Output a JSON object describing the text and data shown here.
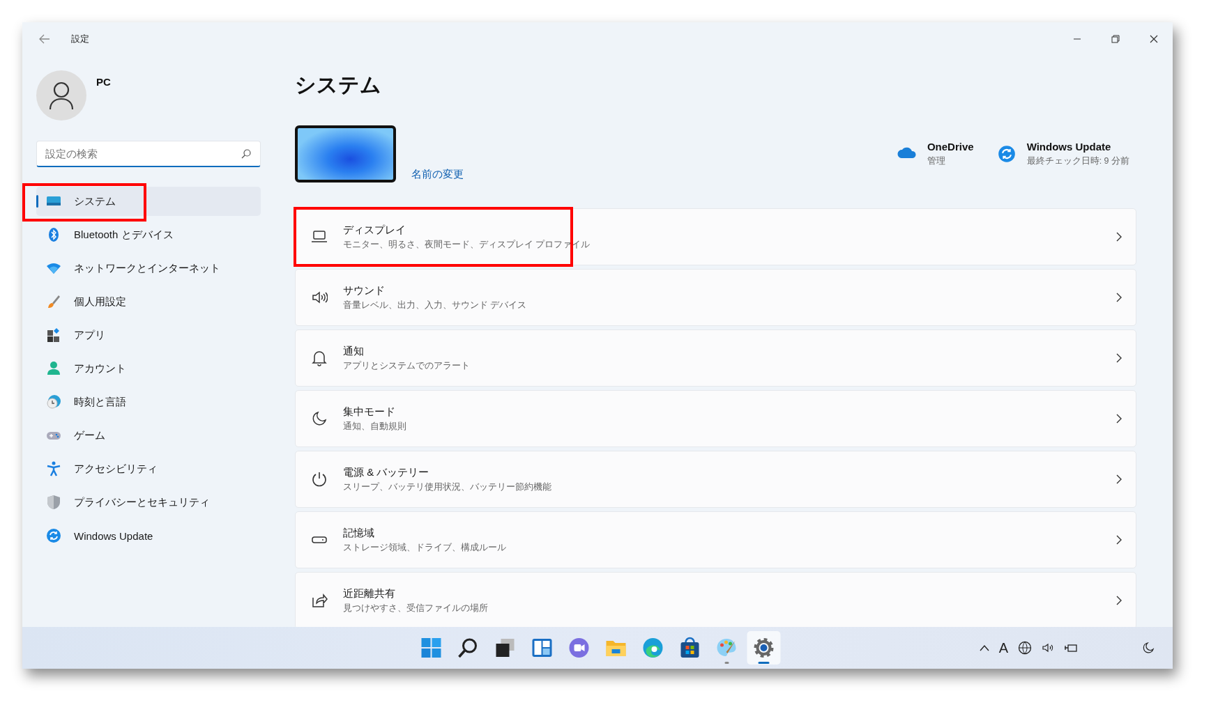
{
  "window": {
    "title": "設定"
  },
  "user": {
    "name": "PC"
  },
  "search": {
    "placeholder": "設定の検索"
  },
  "nav": [
    {
      "label": "システム",
      "selected": true,
      "highlighted": true
    },
    {
      "label": "Bluetooth とデバイス",
      "selected": false,
      "highlighted": false
    },
    {
      "label": "ネットワークとインターネット",
      "selected": false,
      "highlighted": false
    },
    {
      "label": "個人用設定",
      "selected": false,
      "highlighted": false
    },
    {
      "label": "アプリ",
      "selected": false,
      "highlighted": false
    },
    {
      "label": "アカウント",
      "selected": false,
      "highlighted": false
    },
    {
      "label": "時刻と言語",
      "selected": false,
      "highlighted": false
    },
    {
      "label": "ゲーム",
      "selected": false,
      "highlighted": false
    },
    {
      "label": "アクセシビリティ",
      "selected": false,
      "highlighted": false
    },
    {
      "label": "プライバシーとセキュリティ",
      "selected": false,
      "highlighted": false
    },
    {
      "label": "Windows Update",
      "selected": false,
      "highlighted": false
    }
  ],
  "page": {
    "title": "システム",
    "rename_link": "名前の変更",
    "services": [
      {
        "name": "OneDrive",
        "detail": "管理"
      },
      {
        "name": "Windows Update",
        "detail": "最終チェック日時: 9 分前"
      }
    ]
  },
  "cards": [
    {
      "title": "ディスプレイ",
      "subtitle": "モニター、明るさ、夜間モード、ディスプレイ プロファイル",
      "highlighted": true
    },
    {
      "title": "サウンド",
      "subtitle": "音量レベル、出力、入力、サウンド デバイス",
      "highlighted": false
    },
    {
      "title": "通知",
      "subtitle": "アプリとシステムでのアラート",
      "highlighted": false
    },
    {
      "title": "集中モード",
      "subtitle": "通知、自動規則",
      "highlighted": false
    },
    {
      "title": "電源 & バッテリー",
      "subtitle": "スリープ、バッテリ使用状況、バッテリー節約機能",
      "highlighted": false
    },
    {
      "title": "記憶域",
      "subtitle": "ストレージ領域、ドライブ、構成ルール",
      "highlighted": false
    },
    {
      "title": "近距離共有",
      "subtitle": "見つけやすさ、受信ファイルの場所",
      "highlighted": false
    }
  ],
  "taskbar": {
    "apps": [
      {
        "selected": false,
        "running": false
      },
      {
        "selected": false,
        "running": false
      },
      {
        "selected": false,
        "running": false
      },
      {
        "selected": false,
        "running": false
      },
      {
        "selected": false,
        "running": false
      },
      {
        "selected": false,
        "running": false
      },
      {
        "selected": false,
        "running": false
      },
      {
        "selected": false,
        "running": false
      },
      {
        "selected": false,
        "running": true
      },
      {
        "selected": true,
        "running": true
      }
    ],
    "ime": "A"
  }
}
